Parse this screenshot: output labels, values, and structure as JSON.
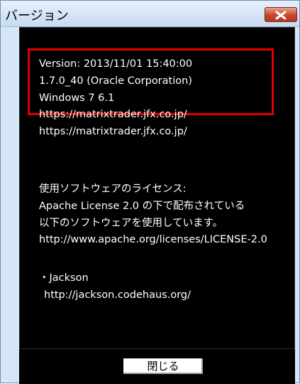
{
  "window": {
    "title": "バージョン",
    "close_icon": "close-x-icon"
  },
  "content": {
    "version_line": "Version: 2013/11/01 15:40:00",
    "java_line": "1.7.0_40 (Oracle Corporation)",
    "os_line": "Windows 7 6.1",
    "url_1": "https://matrixtrader.jfx.co.jp/",
    "url_2": "https://matrixtrader.jfx.co.jp/",
    "license_heading": "使用ソフトウェアのライセンス:",
    "license_line_1": "Apache License 2.0 の下で配布されている",
    "license_line_2": "以下のソフトウェアを使用しています。",
    "license_url": "http://www.apache.org/licenses/LICENSE-2.0",
    "lib_name": "・Jackson",
    "lib_url": "http://jackson.codehaus.org/"
  },
  "footer": {
    "close_label": "閉じる"
  },
  "colors": {
    "background": "#000000",
    "text": "#ffffff",
    "highlight": "#e00000",
    "titlebar": "#d4e6f7"
  }
}
